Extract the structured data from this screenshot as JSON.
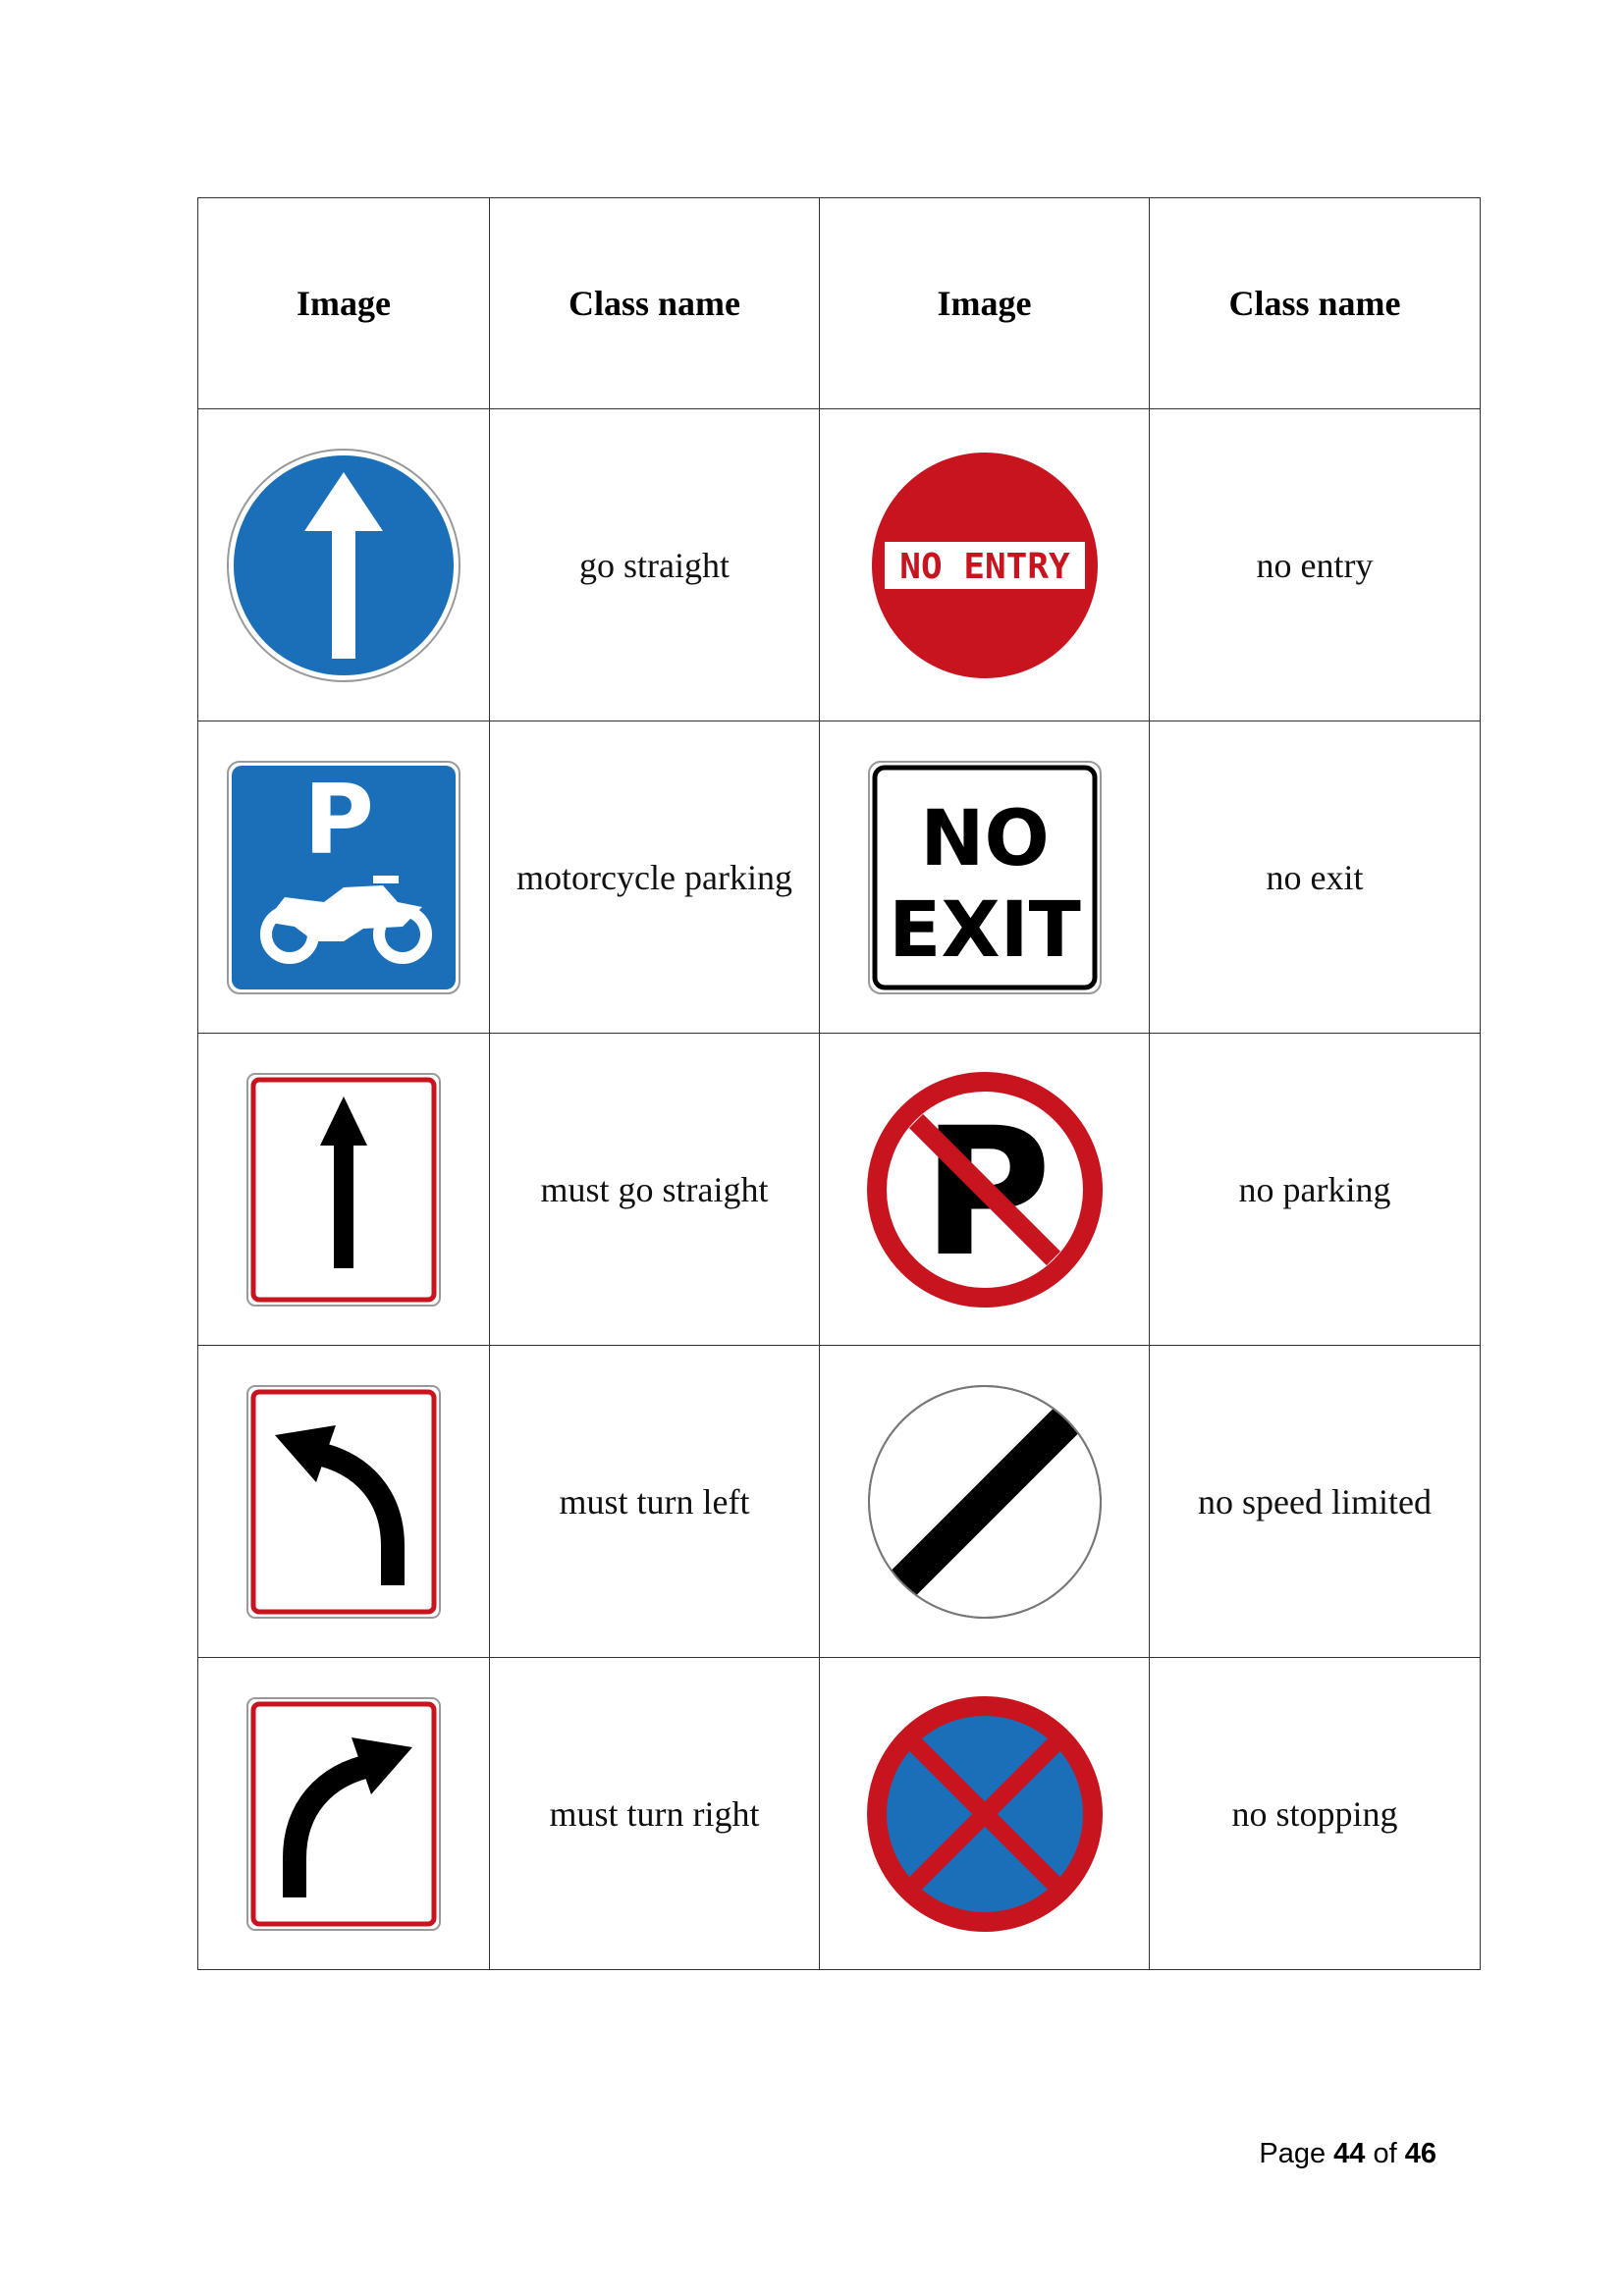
{
  "table": {
    "headers": [
      "Image",
      "Class name",
      "Image",
      "Class name"
    ],
    "rows": [
      {
        "left": {
          "sign": "go-straight-sign",
          "label": "go straight"
        },
        "right": {
          "sign": "no-entry-sign",
          "label": "no entry",
          "sign_text": "NO ENTRY"
        }
      },
      {
        "left": {
          "sign": "motorcycle-parking-sign",
          "label": "motorcycle parking",
          "sign_text": "P"
        },
        "right": {
          "sign": "no-exit-sign",
          "label": "no exit",
          "sign_text_1": "NO",
          "sign_text_2": "EXIT"
        }
      },
      {
        "left": {
          "sign": "must-go-straight-sign",
          "label": "must go straight"
        },
        "right": {
          "sign": "no-parking-sign",
          "label": "no parking",
          "sign_text": "P"
        }
      },
      {
        "left": {
          "sign": "must-turn-left-sign",
          "label": "must turn left"
        },
        "right": {
          "sign": "no-speed-limited-sign",
          "label": "no speed limited"
        }
      },
      {
        "left": {
          "sign": "must-turn-right-sign",
          "label": "must turn right"
        },
        "right": {
          "sign": "no-stopping-sign",
          "label": "no stopping"
        }
      }
    ]
  },
  "colors": {
    "sign_blue": "#1a6fb8",
    "sign_red": "#c8141e",
    "border": "#333333"
  },
  "footer": {
    "prefix": "Page",
    "current": "44",
    "of": "of",
    "total": "46"
  }
}
